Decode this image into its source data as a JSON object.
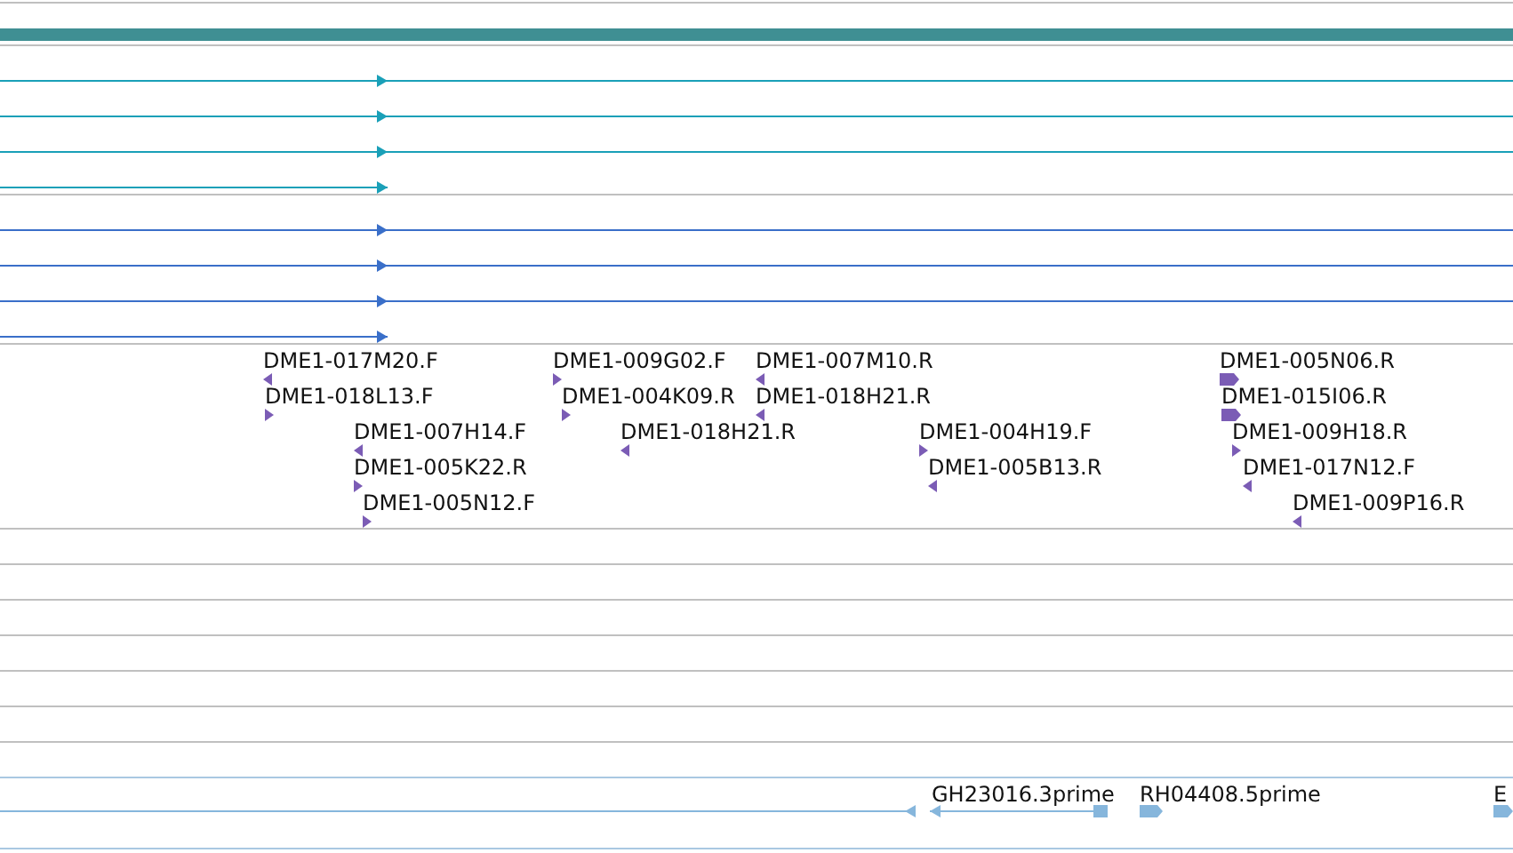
{
  "tracks": [
    {
      "kind": "bar",
      "color": "#3f8f93"
    },
    {
      "kind": "lines",
      "color": "#1aa0b8",
      "features": [
        {
          "forward": true
        },
        {
          "forward": true
        },
        {
          "forward": true
        },
        {
          "forward": true
        }
      ]
    },
    {
      "kind": "lines",
      "color": "#3a6fc9",
      "features": [
        {
          "forward": true
        },
        {
          "forward": true
        },
        {
          "forward": true
        },
        {
          "forward": true
        }
      ]
    },
    {
      "kind": "labeled",
      "color": "#7b5cb5",
      "features": [
        {
          "label": "DME1-017M20.F",
          "forward": false
        },
        {
          "label": "DME1-018L13.F",
          "forward": true
        },
        {
          "label": "DME1-007H14.F",
          "forward": false
        },
        {
          "label": "DME1-005K22.R",
          "forward": true
        },
        {
          "label": "DME1-005N12.F",
          "forward": true
        },
        {
          "label": "DME1-009G02.F",
          "forward": true
        },
        {
          "label": "DME1-004K09.R",
          "forward": true
        },
        {
          "label": "DME1-018H21.R",
          "forward": false
        },
        {
          "label": "DME1-007M10.R",
          "forward": false
        },
        {
          "label": "DME1-018H21.R",
          "forward": false
        },
        {
          "label": "DME1-004H19.F",
          "forward": true
        },
        {
          "label": "DME1-005B13.R",
          "forward": false
        },
        {
          "label": "DME1-005N06.R",
          "forward": true
        },
        {
          "label": "DME1-015I06.R",
          "forward": true
        },
        {
          "label": "DME1-009H18.R",
          "forward": true
        },
        {
          "label": "DME1-017N12.F",
          "forward": false
        },
        {
          "label": "DME1-009P16.R",
          "forward": false
        }
      ]
    },
    {
      "kind": "empty"
    },
    {
      "kind": "empty"
    },
    {
      "kind": "empty"
    },
    {
      "kind": "empty"
    },
    {
      "kind": "empty"
    },
    {
      "kind": "empty"
    },
    {
      "kind": "empty"
    },
    {
      "kind": "labeled",
      "color": "#86b6dc",
      "features": [
        {
          "forward": false
        },
        {
          "label": "GH23016.3prime",
          "forward": false
        },
        {
          "label": "RH04408.5prime",
          "forward": true
        },
        {
          "label": "E",
          "forward": true
        }
      ]
    }
  ]
}
